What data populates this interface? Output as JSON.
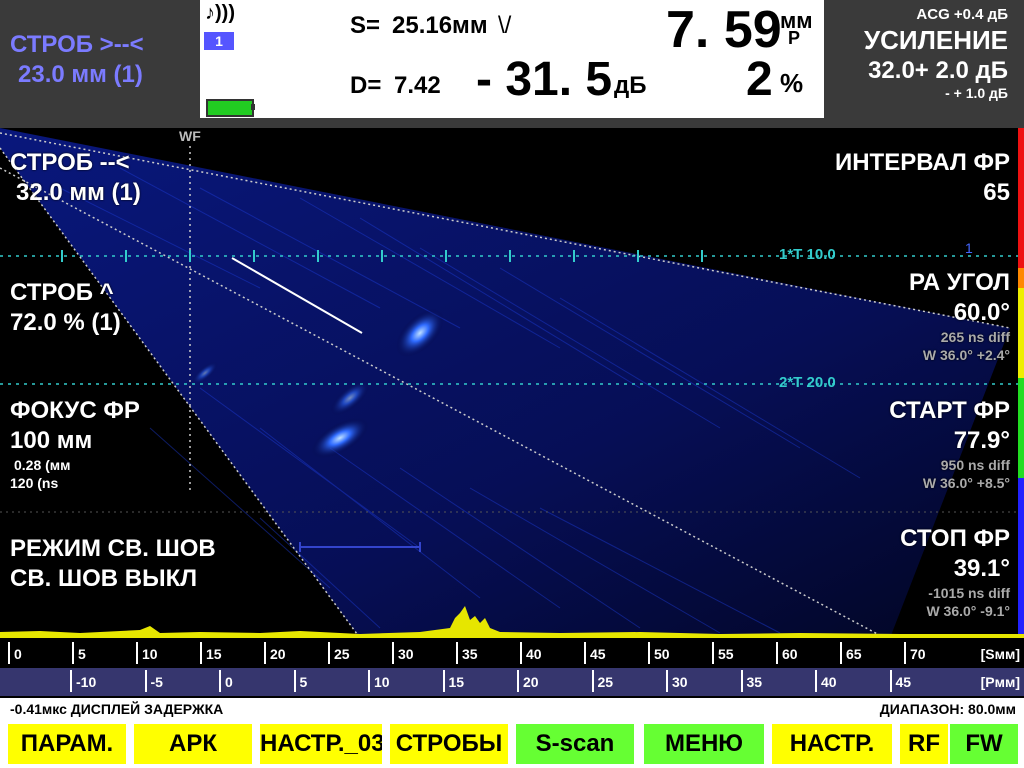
{
  "header": {
    "gate_a_title": "СТРОБ >--<",
    "gate_a_value": "23.0 мм (1)",
    "measurements": {
      "s_label": "S=",
      "s_value": "25.16мм",
      "s_symbol": "\\/",
      "d_label": "D=",
      "d_value": "7.42",
      "db_value": "- 31. 5",
      "db_unit": "дБ",
      "depth_value": "7. 59",
      "depth_unit": "мм",
      "depth_sub": "Р",
      "percent_value": "2",
      "percent_unit": "%",
      "channel": "1",
      "sound_icon_text": "♪)))"
    },
    "gain": {
      "acg": "ACG +0.4 дБ",
      "title": "УСИЛЕНИЕ",
      "value": "32.0+ 2.0 дБ",
      "step": "- + 1.0 дБ"
    }
  },
  "left_panel": {
    "wf_label": "WF",
    "gate_b_title": "СТРОБ --<",
    "gate_b_value": "32.0 мм (1)",
    "gate_level_title": "СТРОБ ^",
    "gate_level_value": "72.0 % (1)",
    "focus_title": "ФОКУС ФР",
    "focus_value": "100 мм",
    "focus_sub1": "0.28 (мм",
    "focus_sub2": "120 (ns",
    "weld_title": "РЕЖИМ СВ. ШОВ",
    "weld_value": "СВ. ШОВ ВЫКЛ"
  },
  "right_panel": {
    "interval_title": "ИНТЕРВАЛ ФР",
    "interval_value": "65",
    "pa_angle_title": "РА УГОЛ",
    "pa_angle_value": "60.0°",
    "pa_angle_sub1": "265 ns diff",
    "pa_angle_sub2": "W 36.0° +2.4°",
    "start_title": "СТАРТ ФР",
    "start_value": "77.9°",
    "start_sub1": "950 ns diff",
    "start_sub2": "W 36.0° +8.5°",
    "stop_title": "СТОП ФР",
    "stop_value": "39.1°",
    "stop_sub1": "-1015 ns diff",
    "stop_sub2": "W 36.0° -9.1°",
    "marker_1": "1"
  },
  "scan": {
    "line1_label": "1*T 10.0",
    "line2_label": "2*T 20.0"
  },
  "scales": {
    "s_ticks": [
      "0",
      "5",
      "10",
      "15",
      "20",
      "25",
      "30",
      "35",
      "40",
      "45",
      "50",
      "55",
      "60",
      "65",
      "70"
    ],
    "s_unit": "[Sмм]",
    "p_ticks": [
      "-10",
      "-5",
      "0",
      "5",
      "10",
      "15",
      "20",
      "25",
      "30",
      "35",
      "40",
      "45"
    ],
    "p_unit": "[Pмм]"
  },
  "status": {
    "delay": "-0.41мкс  ДИСПЛЕЙ ЗАДЕРЖКА",
    "range": "ДИАПАЗОН:  80.0мм"
  },
  "buttons": {
    "param": "ПАРАМ.",
    "apk": "АРК",
    "settings03": "НАСТР._03:",
    "gates": "СТРОБЫ",
    "sscan": "S-scan",
    "menu": "МЕНЮ",
    "settings": "НАСТР.",
    "rf": "RF",
    "fw": "FW"
  },
  "colors": {
    "gate_text": "#7b7bff",
    "button_yellow": "#ffff00",
    "button_green": "#66ff33",
    "tick_cyan": "#33cccc",
    "scale2_bg": "#36366e"
  }
}
